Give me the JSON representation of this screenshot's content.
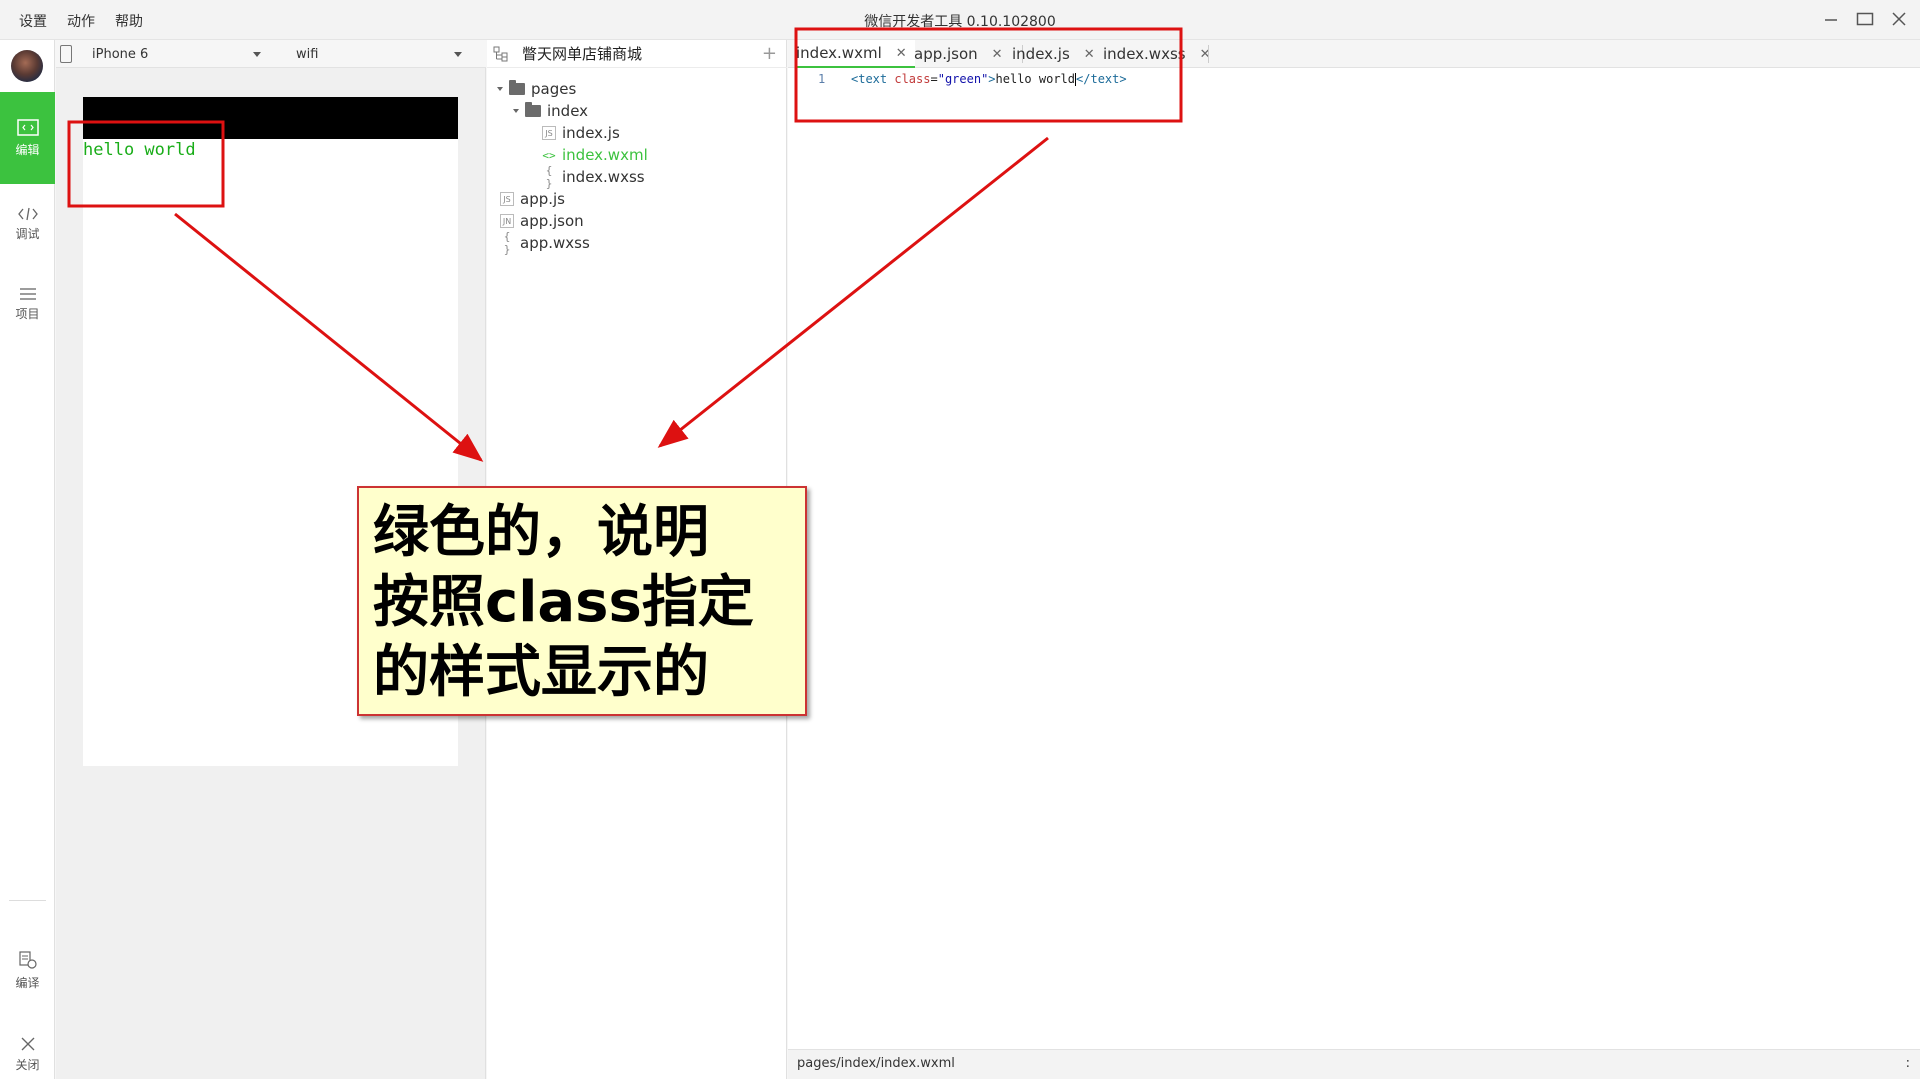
{
  "titlebar": {
    "menu": [
      "设置",
      "动作",
      "帮助"
    ],
    "title": "微信开发者工具 0.10.102800"
  },
  "rail": {
    "items": [
      {
        "label": "编辑",
        "icon": "code-icon",
        "active": true
      },
      {
        "label": "调试",
        "icon": "debug-icon",
        "active": false
      },
      {
        "label": "项目",
        "icon": "list-icon",
        "active": false
      },
      {
        "label": "编译",
        "icon": "compile-icon",
        "active": false
      },
      {
        "label": "关闭",
        "icon": "close-icon",
        "active": false
      }
    ]
  },
  "simulator": {
    "device": "iPhone 6",
    "network": "wifi",
    "content_text": "hello world",
    "text_color": "#1aad19"
  },
  "tree": {
    "project_name": "瞥天网单店铺商城",
    "items": [
      {
        "label": "pages",
        "type": "folder"
      },
      {
        "label": "index",
        "type": "folder"
      },
      {
        "label": "index.js",
        "type": "js"
      },
      {
        "label": "index.wxml",
        "type": "wxml",
        "active": true
      },
      {
        "label": "index.wxss",
        "type": "wxss"
      },
      {
        "label": "app.js",
        "type": "js"
      },
      {
        "label": "app.json",
        "type": "json"
      },
      {
        "label": "app.wxss",
        "type": "wxss"
      }
    ]
  },
  "editor": {
    "tabs": [
      {
        "label": "index.wxml",
        "active": true
      },
      {
        "label": "app.json"
      },
      {
        "label": "index.js"
      },
      {
        "label": "index.wxss"
      }
    ],
    "line_number": "1",
    "code": {
      "open": "<text",
      "attr": "class",
      "eq": "=",
      "value": "\"green\"",
      "close_open": ">",
      "content": "hello world",
      "end_tag": "</text>"
    },
    "status_path": "pages/index/index.wxml",
    "status_right": ":"
  },
  "annotation": {
    "text": "绿色的，说明\n按照class指定\n的样式显示的",
    "box_color": "#dd1111"
  },
  "colors": {
    "accent": "#3cc23f",
    "annotation_red": "#dd1111"
  }
}
